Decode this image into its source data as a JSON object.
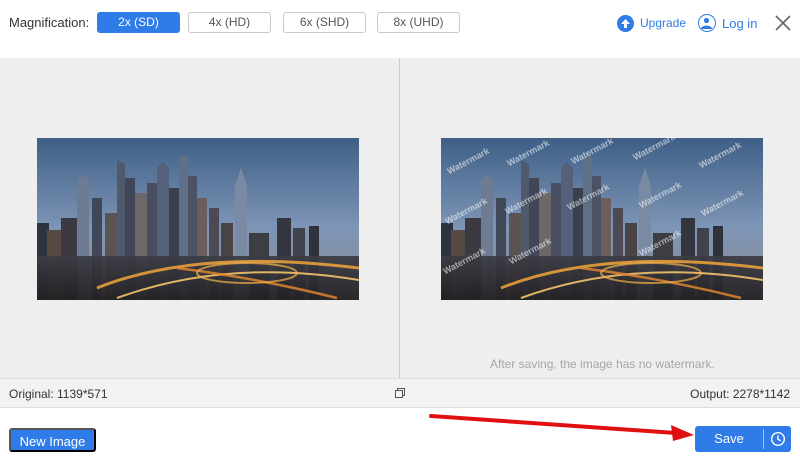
{
  "toolbar": {
    "magnification_label": "Magnification:",
    "options": [
      {
        "label": "2x (SD)",
        "active": true
      },
      {
        "label": "4x (HD)",
        "active": false
      },
      {
        "label": "6x (SHD)",
        "active": false
      },
      {
        "label": "8x (UHD)",
        "active": false
      }
    ],
    "upgrade_label": "Upgrade",
    "login_label": "Log in",
    "icons": {
      "upgrade": "upgrade-arrow-icon",
      "login": "user-icon",
      "close": "close-icon"
    }
  },
  "preview": {
    "watermark_text": "Watermark",
    "note": "After saving, the image has no watermark."
  },
  "status": {
    "original": "Original: 1139*571",
    "output": "Output: 2278*1142",
    "compare_icon": "compare-icon"
  },
  "footer": {
    "new_image_label": "New Image",
    "save_label": "Save",
    "history_icon": "clock-icon"
  },
  "colors": {
    "accent": "#2f7be8",
    "annotation_arrow": "#e01010"
  }
}
